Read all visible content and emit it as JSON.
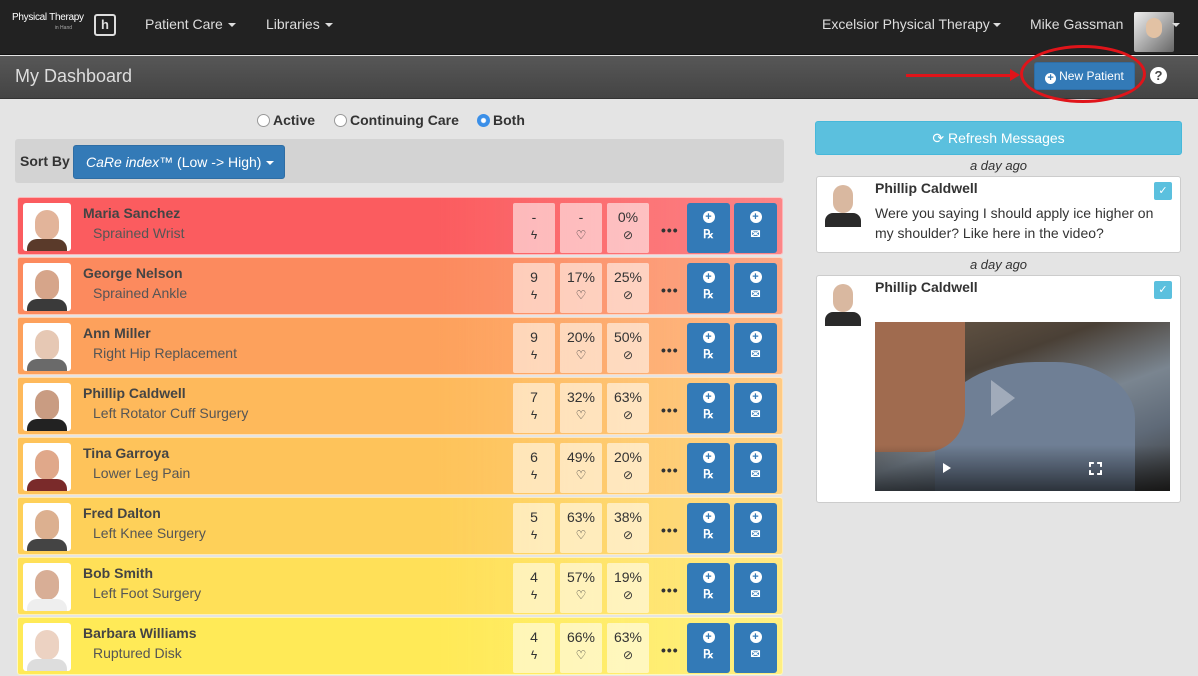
{
  "nav": {
    "logo_line1": "Physical Therapy",
    "logo_line2": "in Hand",
    "logo_mark": "h",
    "patient_care": "Patient Care",
    "libraries": "Libraries",
    "clinic": "Excelsior Physical Therapy",
    "user": "Mike Gassman"
  },
  "header": {
    "title": "My Dashboard",
    "new_patient": "New Patient",
    "help": "?"
  },
  "filters": {
    "options": [
      "Active",
      "Continuing Care",
      "Both"
    ],
    "selected": "Both"
  },
  "sort": {
    "label": "Sort By",
    "value_italic": "CaRe index™",
    "value_rest": " (Low -> High)"
  },
  "patients": [
    {
      "name": "Maria Sanchez",
      "condition": "Sprained Wrist",
      "stat1": "-",
      "stat2": "-",
      "stat3": "0%",
      "color": "#fb5c5f",
      "skin": "#e2b49a",
      "shirt": "#5a3a2a"
    },
    {
      "name": "George Nelson",
      "condition": "Sprained Ankle",
      "stat1": "9",
      "stat2": "17%",
      "stat3": "25%",
      "color": "#fc8a5e",
      "skin": "#d6a58a",
      "shirt": "#3a3a3a"
    },
    {
      "name": "Ann Miller",
      "condition": "Right Hip Replacement",
      "stat1": "9",
      "stat2": "20%",
      "stat3": "50%",
      "color": "#fda15c",
      "skin": "#e6c8b4",
      "shirt": "#6a6a6a"
    },
    {
      "name": "Phillip Caldwell",
      "condition": "Left Rotator Cuff Surgery",
      "stat1": "7",
      "stat2": "32%",
      "stat3": "63%",
      "color": "#feb95b",
      "skin": "#c99c82",
      "shirt": "#222"
    },
    {
      "name": "Tina Garroya",
      "condition": "Lower Leg Pain",
      "stat1": "6",
      "stat2": "49%",
      "stat3": "20%",
      "color": "#fec35a",
      "skin": "#e0a88a",
      "shirt": "#7a2a2a"
    },
    {
      "name": "Fred Dalton",
      "condition": "Left Knee Surgery",
      "stat1": "5",
      "stat2": "63%",
      "stat3": "38%",
      "color": "#fed059",
      "skin": "#dcb090",
      "shirt": "#444"
    },
    {
      "name": "Bob Smith",
      "condition": "Left Foot Surgery",
      "stat1": "4",
      "stat2": "57%",
      "stat3": "19%",
      "color": "#ffe058",
      "skin": "#d8ae96",
      "shirt": "#eee"
    },
    {
      "name": "Barbara Williams",
      "condition": "Ruptured Disk",
      "stat1": "4",
      "stat2": "66%",
      "stat3": "63%",
      "color": "#ffea57",
      "skin": "#ecd2c2",
      "shirt": "#ddd"
    }
  ],
  "icons": {
    "stat1": "bolt-icon",
    "stat2": "heart-icon",
    "stat3": "check-circle-icon",
    "btn1": "prescription-icon",
    "btn2": "envelope-icon"
  },
  "messages": {
    "refresh": "Refresh Messages",
    "items": [
      {
        "ago": "a day ago",
        "sender": "Phillip Caldwell",
        "text": "Were you saying I should apply ice higher on my shoulder? Like here in the video?"
      },
      {
        "ago": "a day ago",
        "sender": "Phillip Caldwell",
        "text": ""
      }
    ]
  },
  "colors": {
    "primary": "#337ab7",
    "info": "#5bc0de",
    "annotation": "#e0141a"
  }
}
